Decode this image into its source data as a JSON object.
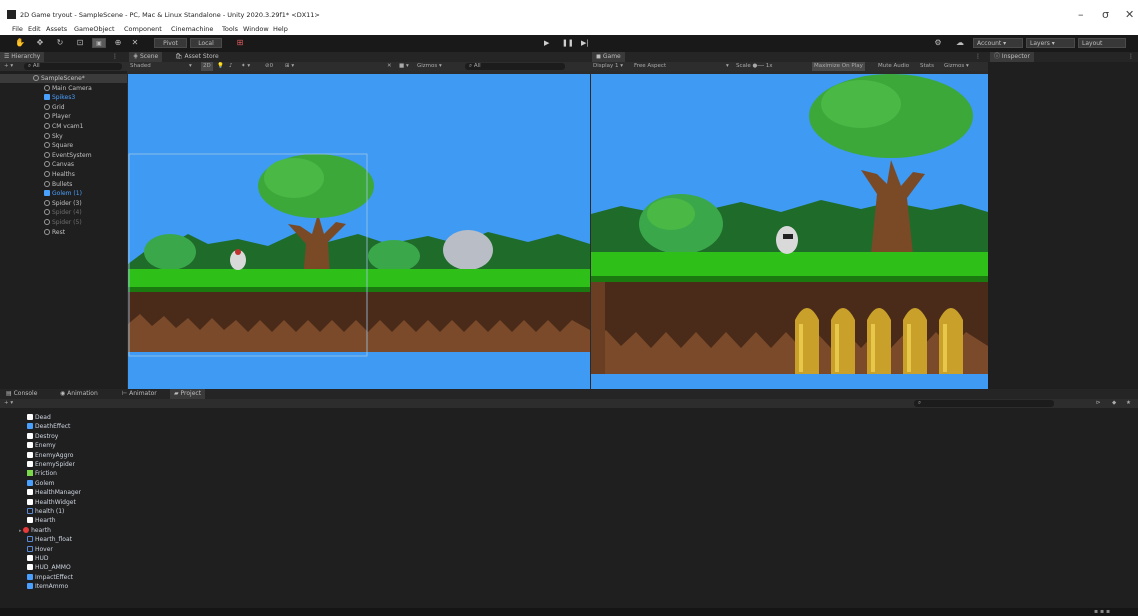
{
  "window": {
    "title": "2D Game tryout - SampleScene - PC, Mac & Linux Standalone - Unity 2020.3.29f1* <DX11>",
    "controls": [
      "–",
      "σ",
      "✕"
    ]
  },
  "menu": [
    "File",
    "Edit",
    "Assets",
    "GameObject",
    "Component",
    "Cinemachine",
    "Tools",
    "Window",
    "Help"
  ],
  "toolbar": {
    "pivot": "Pivot",
    "local": "Local",
    "account": "Account",
    "layers": "Layers",
    "layout": "Layout"
  },
  "hierarchy": {
    "tab": "Hierarchy",
    "search_placeholder": "All",
    "scene": "SampleScene*",
    "items": [
      {
        "label": "Main Camera",
        "style": "normal"
      },
      {
        "label": "Spikes3",
        "style": "blue"
      },
      {
        "label": "Grid",
        "style": "normal"
      },
      {
        "label": "Player",
        "style": "normal"
      },
      {
        "label": "CM vcam1",
        "style": "normal"
      },
      {
        "label": "Sky",
        "style": "normal"
      },
      {
        "label": "Square",
        "style": "normal"
      },
      {
        "label": "EventSystem",
        "style": "normal"
      },
      {
        "label": "Canvas",
        "style": "normal"
      },
      {
        "label": "Healths",
        "style": "normal"
      },
      {
        "label": "Bullets",
        "style": "normal"
      },
      {
        "label": "Golem (1)",
        "style": "blue"
      },
      {
        "label": "Spider (3)",
        "style": "normal"
      },
      {
        "label": "Spider (4)",
        "style": "dim"
      },
      {
        "label": "Spider (5)",
        "style": "dim"
      },
      {
        "label": "Rest",
        "style": "normal"
      }
    ]
  },
  "scene": {
    "tabs": [
      "Scene",
      "Asset Store"
    ],
    "shading": "Shaded",
    "mode_2d": "2D",
    "gizmos": "Gizmos",
    "search_placeholder": "All"
  },
  "game": {
    "tab": "Game",
    "display": "Display 1",
    "aspect": "Free Aspect",
    "scale_label": "Scale",
    "scale_value": "1x",
    "toggles": [
      "Maximize On Play",
      "Mute Audio",
      "Stats",
      "Gizmos"
    ]
  },
  "inspector": {
    "tab": "Inspector"
  },
  "bottom": {
    "tabs": [
      "Console",
      "Animation",
      "Animator",
      "Project"
    ],
    "active_tab": "Project"
  },
  "project": {
    "items": [
      {
        "label": "Dead",
        "icon": "script"
      },
      {
        "label": "DeathEffect",
        "icon": "prefab"
      },
      {
        "label": "Destroy",
        "icon": "script"
      },
      {
        "label": "Enemy",
        "icon": "script"
      },
      {
        "label": "EnemyAggro",
        "icon": "script"
      },
      {
        "label": "EnemySpider",
        "icon": "script"
      },
      {
        "label": "Friction",
        "icon": "physics"
      },
      {
        "label": "Golem",
        "icon": "prefab"
      },
      {
        "label": "HealthManager",
        "icon": "script"
      },
      {
        "label": "HealthWidget",
        "icon": "script"
      },
      {
        "label": "health (1)",
        "icon": "anim"
      },
      {
        "label": "Hearth",
        "icon": "script"
      },
      {
        "label": "hearth",
        "icon": "sprite"
      },
      {
        "label": "Hearth_float",
        "icon": "anim"
      },
      {
        "label": "Hover",
        "icon": "anim"
      },
      {
        "label": "HUD",
        "icon": "script"
      },
      {
        "label": "HUD_AMMO",
        "icon": "script"
      },
      {
        "label": "ImpactEffect",
        "icon": "prefab"
      },
      {
        "label": "ItemAmmo",
        "icon": "prefab"
      }
    ]
  },
  "colors": {
    "sky": "#3e9af2",
    "grass": "#2fbf19",
    "dirt": "#4a2a18",
    "tree_leaves": "#3ca83a",
    "trunk": "#7a4a26",
    "bullet": "#c9a12a",
    "selection_blue": "#4aa0ff"
  }
}
